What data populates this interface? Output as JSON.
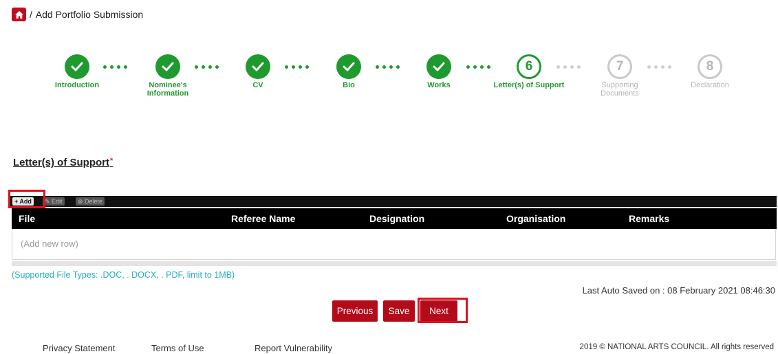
{
  "breadcrumb": {
    "separator": "/",
    "title": "Add Portfolio Submission"
  },
  "steps": [
    {
      "label": "Introduction",
      "state": "done"
    },
    {
      "label": "Nominee's Information",
      "state": "done"
    },
    {
      "label": "CV",
      "state": "done"
    },
    {
      "label": "Bio",
      "state": "done"
    },
    {
      "label": "Works",
      "state": "done"
    },
    {
      "number": "6",
      "label": "Letter(s) of Support",
      "state": "current"
    },
    {
      "number": "7",
      "label": "Supporting Documents",
      "state": "future"
    },
    {
      "number": "8",
      "label": "Declaration",
      "state": "future"
    }
  ],
  "section": {
    "title": "Letter(s) of Support",
    "required_mark": "*"
  },
  "toolbar": {
    "add": "+ Add",
    "edit": "✎ Edit",
    "delete": "⊗ Delete"
  },
  "table": {
    "columns": [
      "File",
      "Referee Name",
      "Designation",
      "Organisation",
      "Remarks"
    ],
    "placeholder": "(Add new row)"
  },
  "file_types_note": "(Supported File Types: .DOC, . DOCX, . PDF, limit to 1MB)",
  "autosave": "Last Auto Saved on : 08 February 2021 08:46:30",
  "buttons": {
    "previous": "Previous",
    "save": "Save",
    "next": "Next"
  },
  "footer": {
    "links": [
      "Privacy Statement",
      "Terms of Use",
      "Report Vulnerability"
    ],
    "copyright": "2019 © NATIONAL ARTS COUNCIL.  All rights reserved"
  },
  "colors": {
    "brand_red": "#b30b1a",
    "success_green": "#1f9a2e",
    "info_teal": "#25aebd"
  }
}
